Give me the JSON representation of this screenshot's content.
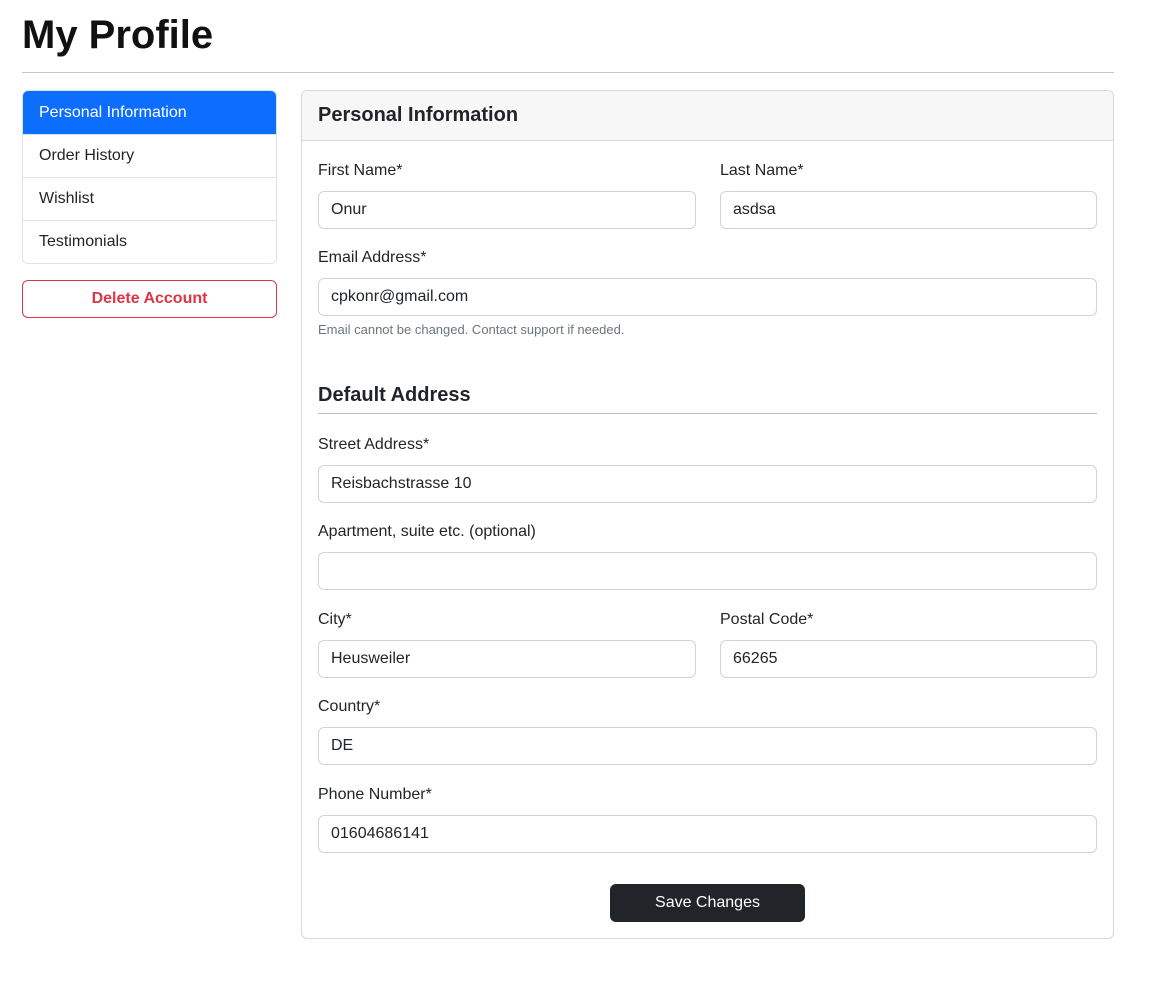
{
  "page": {
    "title": "My Profile"
  },
  "sidebar": {
    "items": [
      {
        "label": "Personal Information",
        "active": true
      },
      {
        "label": "Order History",
        "active": false
      },
      {
        "label": "Wishlist",
        "active": false
      },
      {
        "label": "Testimonials",
        "active": false
      }
    ],
    "delete_label": "Delete Account"
  },
  "form": {
    "header": "Personal Information",
    "first_name": {
      "label": "First Name*",
      "value": "Onur"
    },
    "last_name": {
      "label": "Last Name*",
      "value": "asdsa"
    },
    "email": {
      "label": "Email Address*",
      "value": "cpkonr@gmail.com",
      "help": "Email cannot be changed. Contact support if needed."
    },
    "address_title": "Default Address",
    "street": {
      "label": "Street Address*",
      "value": "Reisbachstrasse 10"
    },
    "apartment": {
      "label": "Apartment, suite etc. (optional)",
      "value": ""
    },
    "city": {
      "label": "City*",
      "value": "Heusweiler"
    },
    "postal": {
      "label": "Postal Code*",
      "value": "66265"
    },
    "country": {
      "label": "Country*",
      "value": "DE"
    },
    "phone": {
      "label": "Phone Number*",
      "value": "01604686141"
    },
    "save_label": "Save Changes"
  },
  "colors": {
    "primary": "#0d6efd",
    "danger": "#dc3545",
    "dark": "#212529"
  }
}
